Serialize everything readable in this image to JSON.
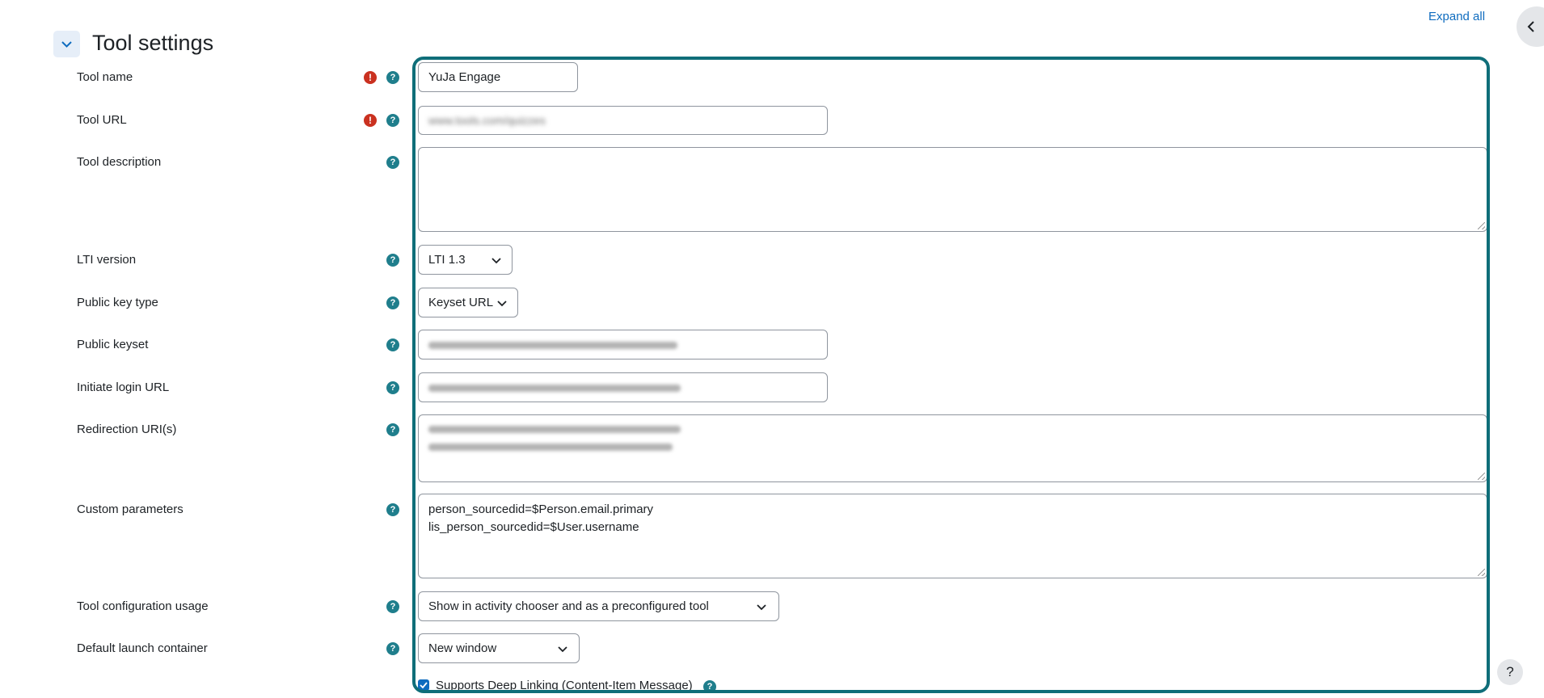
{
  "header": {
    "expand_all": "Expand all",
    "section_title": "Tool settings"
  },
  "fields": {
    "tool_name": {
      "label": "Tool name",
      "value": "YuJa Engage"
    },
    "tool_url": {
      "label": "Tool URL",
      "value": "www.tools.com/quizzes"
    },
    "tool_description": {
      "label": "Tool description",
      "value": ""
    },
    "lti_version": {
      "label": "LTI version",
      "value": "LTI 1.3"
    },
    "public_key_type": {
      "label": "Public key type",
      "value": "Keyset URL"
    },
    "public_keyset": {
      "label": "Public keyset"
    },
    "initiate_login_url": {
      "label": "Initiate login URL"
    },
    "redirection_uris": {
      "label": "Redirection URI(s)"
    },
    "custom_parameters": {
      "label": "Custom parameters",
      "line1": "person_sourcedid=$Person.email.primary",
      "line2": "lis_person_sourcedid=$User.username"
    },
    "tool_configuration_usage": {
      "label": "Tool configuration usage",
      "value": "Show in activity chooser and as a preconfigured tool"
    },
    "default_launch_container": {
      "label": "Default launch container",
      "value": "New window"
    },
    "deep_linking": {
      "label": "Supports Deep Linking (Content-Item Message)",
      "checked": true
    }
  },
  "icons": {
    "required": "required-icon",
    "help": "help-icon",
    "collapse": "chevron-down-icon",
    "drawer": "chevron-left-icon",
    "floating_help": "question-mark-icon"
  },
  "floating_help": "?",
  "colors": {
    "highlight_border": "#0f6e79",
    "link": "#0f6cbf",
    "required": "#ca3120",
    "help": "#1f7e8c"
  }
}
